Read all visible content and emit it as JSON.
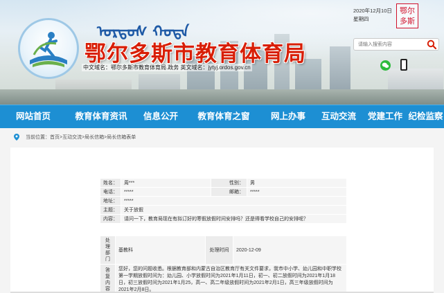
{
  "header": {
    "mongolian_script": "ᠣᠷᠳᠣᠰ ᠬᠣᠲᠠ",
    "site_title": "鄂尔多斯市教育体育局",
    "domains_text": "中文域名：鄂尔多斯市教育体育局.政务   英文域名：jytyj.ordos.gov.cn",
    "date": "2020年12月10日",
    "weekday": "星期四",
    "seal_text_1": "鄂尔",
    "seal_text_2": "多斯",
    "search_placeholder": "请输入搜索内容",
    "icons": [
      "logo-emblem",
      "search-icon",
      "wechat-icon",
      "mobile-icon",
      "location-pin-icon"
    ]
  },
  "nav": {
    "items": [
      {
        "label": "网站首页"
      },
      {
        "label": "教育体育资讯"
      },
      {
        "label": "信息公开"
      },
      {
        "label": "教育体育之窗"
      },
      {
        "label": "网上办事"
      },
      {
        "label": "互动交流"
      },
      {
        "label": "党建工作"
      },
      {
        "label": "纪检监察"
      }
    ],
    "color": "#1d8fd3"
  },
  "breadcrumb": {
    "prefix": "当前位置：",
    "path": "首页>互动交流>局长信箱>局长信箱表单"
  },
  "letter": {
    "name_label": "姓名：",
    "name_value": "周***",
    "gender_label": "性别：",
    "gender_value": "男",
    "phone_label": "电话：",
    "phone_value": "*****",
    "email_label": "邮箱：",
    "email_value": "*****",
    "address_label": "地址：",
    "address_value": "*****",
    "subject_label": "主题：",
    "subject_value": "关于放假",
    "content_label": "内容：",
    "content_value": "请问一下，教育局现在有拟订好的寒假放假时间安排吗？还是得看学校自己的安排呢？"
  },
  "reply": {
    "dept_label_1": "处理",
    "dept_label_2": "部门",
    "dept_value": "基教科",
    "time_label": "处理时间",
    "time_value": "2020-12-09",
    "answer_label_1": "答复",
    "answer_label_2": "内容",
    "answer_text": "您好，您的问题收悉。根据教育部和内蒙古自治区教育厅有关文件要求，我市中小学、幼儿园和中职学校第一学期放假时间为：幼儿园、小学放假时间为2021年1月11日，初一、初二放假时间为2021年1月18日，初三放假时间为2021年1月25，高一、高二年级放假时间为2021年2月1日，高三年级放假时间为2021年2月8日。"
  }
}
